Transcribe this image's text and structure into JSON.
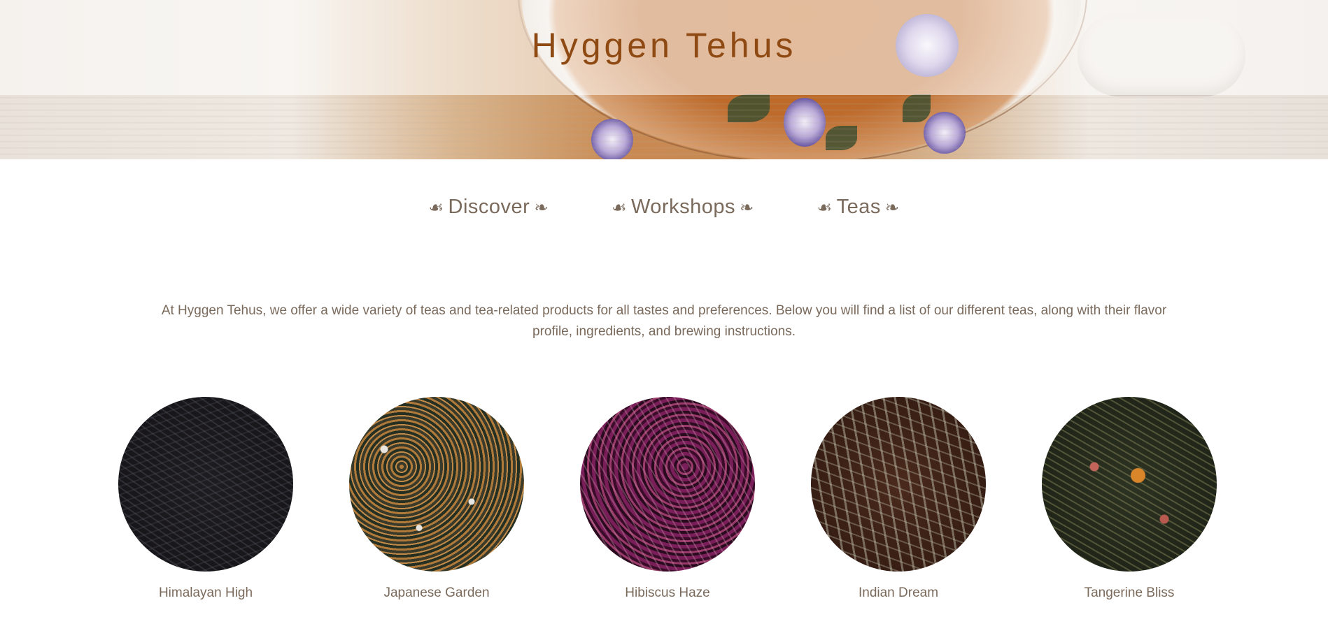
{
  "header": {
    "title": "Hyggen Tehus"
  },
  "nav": {
    "ornament_left": "☙",
    "ornament_right": "❧",
    "items": [
      {
        "label": "Discover"
      },
      {
        "label": "Workshops"
      },
      {
        "label": "Teas"
      }
    ]
  },
  "intro": {
    "text": "At Hyggen Tehus, we offer a wide variety of teas and tea-related products for all tastes and preferences. Below you will find a list of our different teas, along with their flavor profile, ingredients, and brewing instructions."
  },
  "teas": [
    {
      "name": "Himalayan High"
    },
    {
      "name": "Japanese Garden"
    },
    {
      "name": "Hibiscus Haze"
    },
    {
      "name": "Indian Dream"
    },
    {
      "name": "Tangerine Bliss"
    }
  ],
  "colors": {
    "title": "#8e4a12",
    "text": "#7a6a5c",
    "background": "#ffffff"
  }
}
